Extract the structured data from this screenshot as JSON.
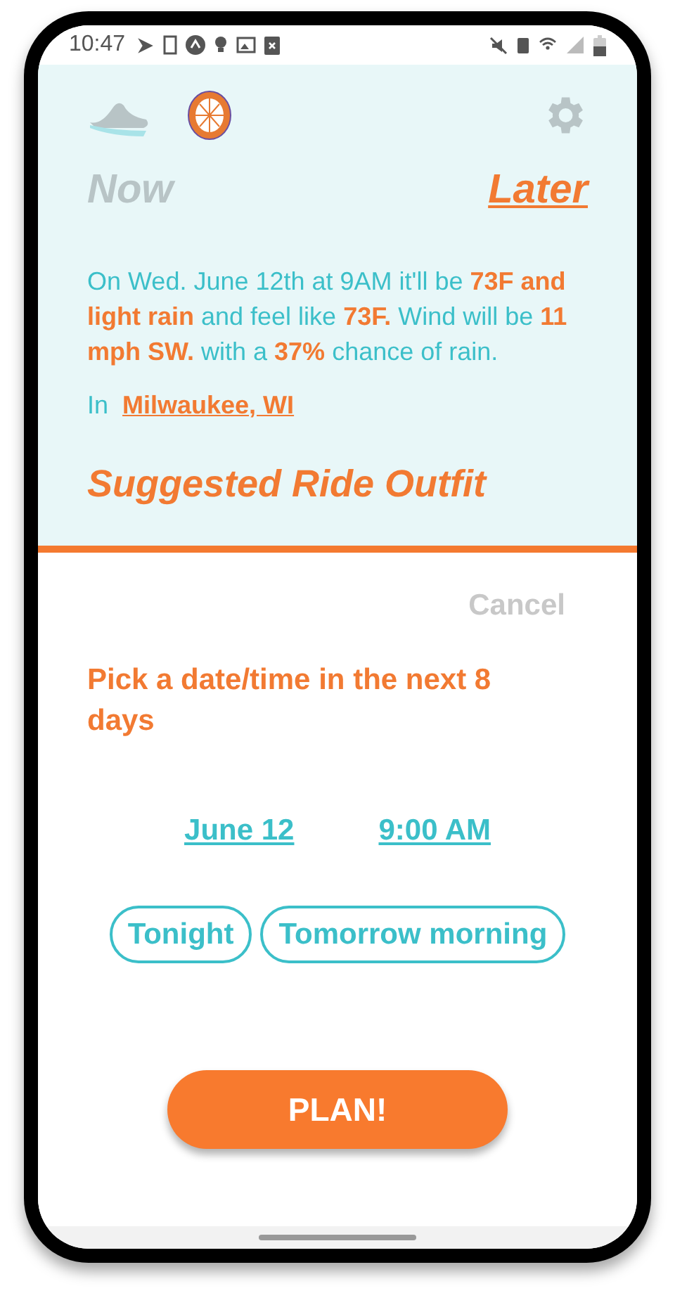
{
  "status_bar": {
    "time": "10:47"
  },
  "tabs": [
    {
      "label": "Now",
      "selected": false
    },
    {
      "label": "Later",
      "selected": true
    }
  ],
  "forecast": {
    "segments": [
      {
        "text": "On Wed. June 12th at 9AM it'll be ",
        "highlight": false
      },
      {
        "text": "73F and light rain",
        "highlight": true
      },
      {
        "text": " and feel like ",
        "highlight": false
      },
      {
        "text": "73F.",
        "highlight": true
      },
      {
        "text": " Wind will be ",
        "highlight": false
      },
      {
        "text": "11 mph SW.",
        "highlight": true
      },
      {
        "text": "  with a  ",
        "highlight": false
      },
      {
        "text": "37%",
        "highlight": true
      },
      {
        "text": " chance of rain.",
        "highlight": false
      }
    ],
    "location_prefix": "In",
    "location": "Milwaukee, WI"
  },
  "section_title": "Suggested Ride Outfit",
  "sheet": {
    "cancel": "Cancel",
    "prompt": "Pick a date/time in the next 8 days",
    "date": "June 12",
    "time": "9:00 AM",
    "presets": [
      {
        "label": "Tonight"
      },
      {
        "label": "Tomorrow morning"
      }
    ],
    "plan_button": "PLAN!"
  }
}
